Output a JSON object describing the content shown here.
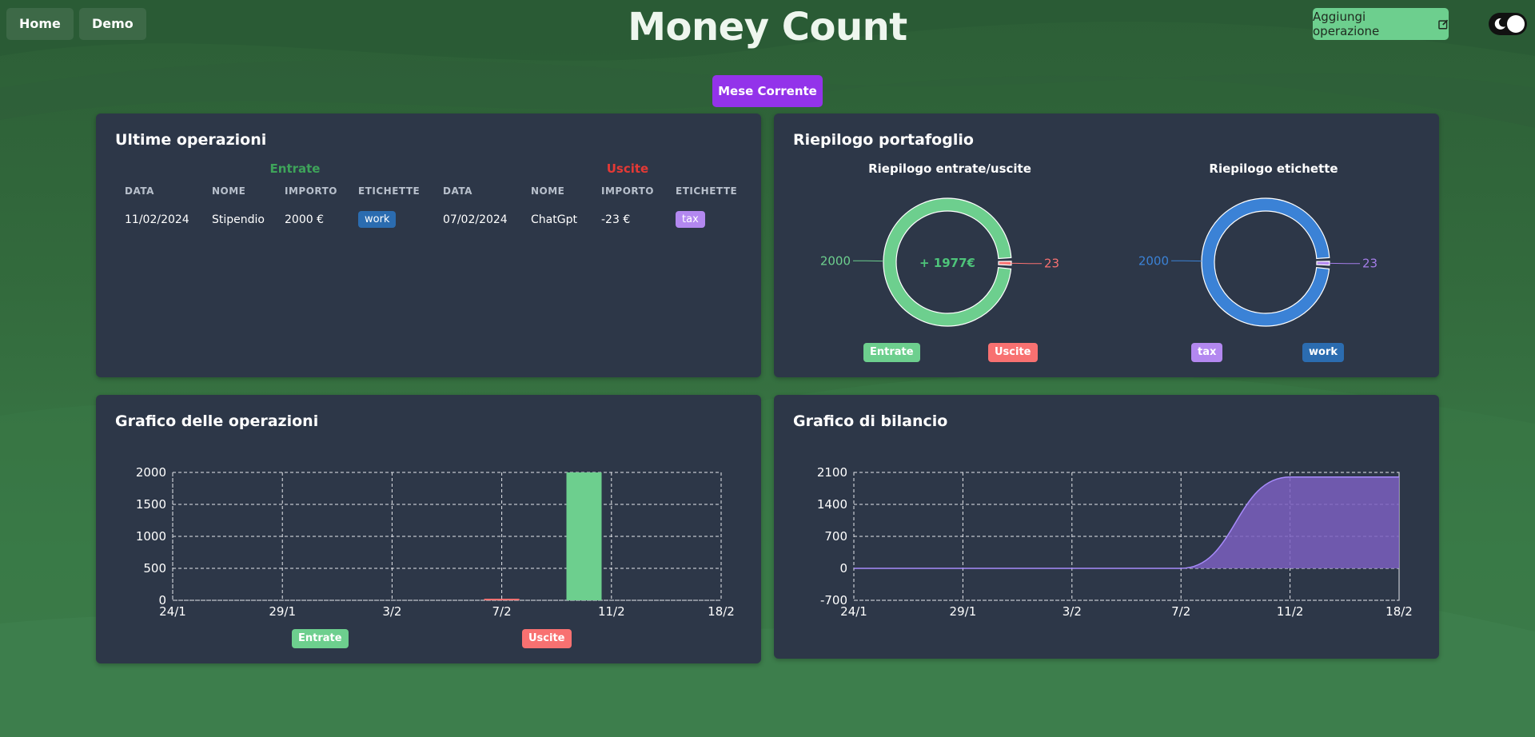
{
  "nav": {
    "home": "Home",
    "demo": "Demo"
  },
  "title": "Money Count",
  "add_button": {
    "label": "Aggiungi operazione",
    "icon": "edit-square-icon"
  },
  "theme_toggle": {
    "state": "dark"
  },
  "period_button": "Mese Corrente",
  "colors": {
    "income": "#6dcf8e",
    "expense": "#f87171",
    "income_text": "#3ea35a",
    "expense_text": "#e53935",
    "tag_work": "#2b6cb0",
    "tag_tax": "#b388f0",
    "balance": "#7b5fbf",
    "card": "#2d3748"
  },
  "operations": {
    "title": "Ultime operazioni",
    "income_header": "Entrate",
    "expense_header": "Uscite",
    "columns": [
      "DATA",
      "NOME",
      "IMPORTO",
      "ETICHETTE",
      "DATA",
      "NOME",
      "IMPORTO",
      "ETICHETTE"
    ],
    "rows": [
      {
        "in_date": "11/02/2024",
        "in_name": "Stipendio",
        "in_amount": "2000 €",
        "in_tag": "work",
        "out_date": "07/02/2024",
        "out_name": "ChatGpt",
        "out_amount": "-23 €",
        "out_tag": "tax"
      }
    ]
  },
  "portfolio": {
    "title": "Riepilogo portafoglio",
    "io_title": "Riepilogo entrate/uscite",
    "tags_title": "Riepilogo etichette",
    "io_center": "+ 1977€",
    "io_legend": [
      "Entrate",
      "Uscite"
    ],
    "tags_legend": [
      "tax",
      "work"
    ]
  },
  "ops_chart_title": "Grafico delle operazioni",
  "balance_chart_title": "Grafico di bilancio",
  "ops_legend": [
    "Entrate",
    "Uscite"
  ],
  "chart_data": [
    {
      "type": "pie",
      "title": "Riepilogo entrate/uscite",
      "labels": [
        "Entrate",
        "Uscite"
      ],
      "values": [
        2000,
        23
      ],
      "center_label": "+ 1977€"
    },
    {
      "type": "pie",
      "title": "Riepilogo etichette",
      "labels": [
        "work",
        "tax"
      ],
      "values": [
        2000,
        23
      ]
    },
    {
      "type": "bar",
      "title": "Grafico delle operazioni",
      "x_ticks": [
        "24/1",
        "29/1",
        "3/2",
        "7/2",
        "11/2",
        "18/2"
      ],
      "series": [
        {
          "name": "Entrate",
          "points": [
            {
              "x": "10/2",
              "y": 2000
            }
          ]
        },
        {
          "name": "Uscite",
          "points": [
            {
              "x": "7/2",
              "y": 23
            }
          ]
        }
      ],
      "y_ticks": [
        0,
        500,
        1000,
        1500,
        2000
      ],
      "ylim": [
        0,
        2000
      ],
      "grid": true,
      "legend": "bottom"
    },
    {
      "type": "area",
      "title": "Grafico di bilancio",
      "x_ticks": [
        "24/1",
        "29/1",
        "3/2",
        "7/2",
        "11/2",
        "18/2"
      ],
      "points": [
        {
          "x": "24/1",
          "y": 0
        },
        {
          "x": "7/2",
          "y": 0
        },
        {
          "x": "11/2",
          "y": 2000
        },
        {
          "x": "18/2",
          "y": 2000
        }
      ],
      "y_ticks": [
        -700,
        0,
        700,
        1400,
        2100
      ],
      "ylim": [
        -700,
        2100
      ],
      "grid": true
    }
  ]
}
